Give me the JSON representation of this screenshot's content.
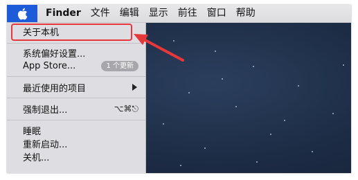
{
  "menubar": {
    "app_name": "Finder",
    "items": [
      "文件",
      "编辑",
      "显示",
      "前往",
      "窗口",
      "帮助"
    ]
  },
  "apple_menu": {
    "about": "关于本机",
    "system_prefs": "系统偏好设置...",
    "app_store": "App Store...",
    "app_store_badge": "1 个更新",
    "recent_items": "最近使用的项目",
    "force_quit": "强制退出...",
    "force_quit_shortcut": "⌥⌘⎋",
    "sleep": "睡眠",
    "restart": "重新启动...",
    "shutdown": "关机..."
  },
  "icons": {
    "apple": "apple-logo-icon",
    "submenu": "chevron-right-icon",
    "annotation": "red-arrow-icon"
  },
  "colors": {
    "apple_highlight": "#1e5bd8",
    "annotation": "#e6373a",
    "menu_bg": "#dedde1",
    "desktop": "#1d2c45"
  }
}
